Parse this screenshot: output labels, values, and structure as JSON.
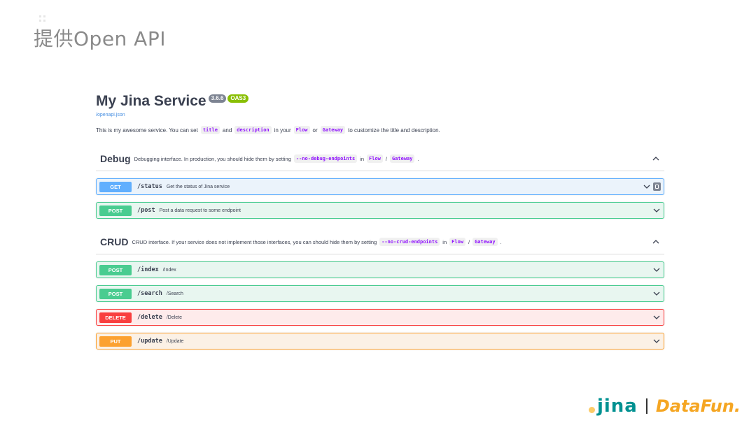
{
  "slide": {
    "title": "提供Open API"
  },
  "info": {
    "title": "My Jina Service",
    "version": "3.6.6",
    "oas": "OAS3",
    "spec_link": "/openapi.json",
    "desc_parts": [
      "This is my awesome service. You can set",
      "title",
      "and",
      "description",
      "in your",
      "Flow",
      "or",
      "Gateway",
      "to customize the title and description."
    ]
  },
  "tags": [
    {
      "name": "Debug",
      "desc_parts": [
        "Debugging interface. In production, you should hide them by setting",
        "--no-debug-endpoints",
        "in",
        "Flow",
        "/",
        "Gateway",
        "."
      ],
      "ops": [
        {
          "method": "GET",
          "path": "/status",
          "summary": "Get the status of Jina service"
        },
        {
          "method": "POST",
          "path": "/post",
          "summary": "Post a data request to some endpoint"
        }
      ]
    },
    {
      "name": "CRUD",
      "desc_parts": [
        "CRUD interface. If your service does not implement those interfaces, you can should hide them by setting",
        "--no-crud-endpoints",
        "in",
        "Flow",
        "/",
        "Gateway",
        "."
      ],
      "ops": [
        {
          "method": "POST",
          "path": "/index",
          "summary": "/Index"
        },
        {
          "method": "POST",
          "path": "/search",
          "summary": "/Search"
        },
        {
          "method": "DELETE",
          "path": "/delete",
          "summary": "/Delete"
        },
        {
          "method": "PUT",
          "path": "/update",
          "summary": "/Update"
        }
      ]
    }
  ],
  "footer": {
    "jina": "jina",
    "datafun": "DataFun."
  },
  "colors": {
    "get": "#61affe",
    "post": "#49cc90",
    "delete": "#f93e3e",
    "put": "#fca130",
    "jina": "#009191",
    "datafun": "#f5a623"
  }
}
